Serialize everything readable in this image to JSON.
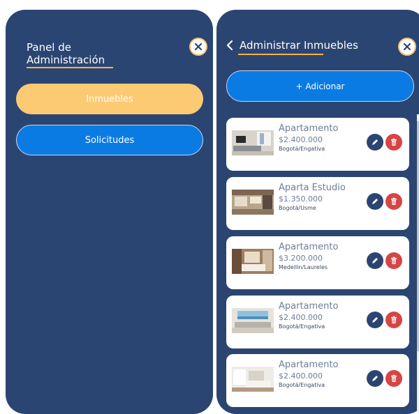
{
  "admin_panel": {
    "title_line1": "Panel de",
    "title_line2": "Administración",
    "menu": [
      {
        "label": "Inmuebles",
        "active": true
      },
      {
        "label": "Solicitudes",
        "active": false
      }
    ]
  },
  "properties_panel": {
    "title": "Administrar Inmuebles",
    "add_label": "+ Adicionar",
    "items": [
      {
        "type": "Apartamento",
        "price": "$2.400.000",
        "location": "Bogotá/Engativa",
        "thumb": "living-room-photo"
      },
      {
        "type": "Aparta Estudio",
        "price": "$1.350.000",
        "location": "Bogotá/Usme",
        "thumb": "studio-kitchen-photo"
      },
      {
        "type": "Apartamento",
        "price": "$3.200.000",
        "location": "Medellin/Laureles",
        "thumb": "bedroom-photo"
      },
      {
        "type": "Apartamento",
        "price": "$2.400.000",
        "location": "Bogotá/Engativa",
        "thumb": "sea-view-living-photo"
      },
      {
        "type": "Apartamento",
        "price": "$2.400.000",
        "location": "Bogotá/Engativa",
        "thumb": "bright-bedroom-photo"
      }
    ]
  },
  "icons": {
    "close": "close-icon",
    "back": "chevron-left-icon",
    "edit": "pencil-icon",
    "delete": "trash-icon"
  },
  "colors": {
    "panel_bg": "#2b4572",
    "active_button": "#fdca74",
    "primary_button": "#0b7be4",
    "accent": "#f5b642",
    "delete": "#d64545"
  }
}
